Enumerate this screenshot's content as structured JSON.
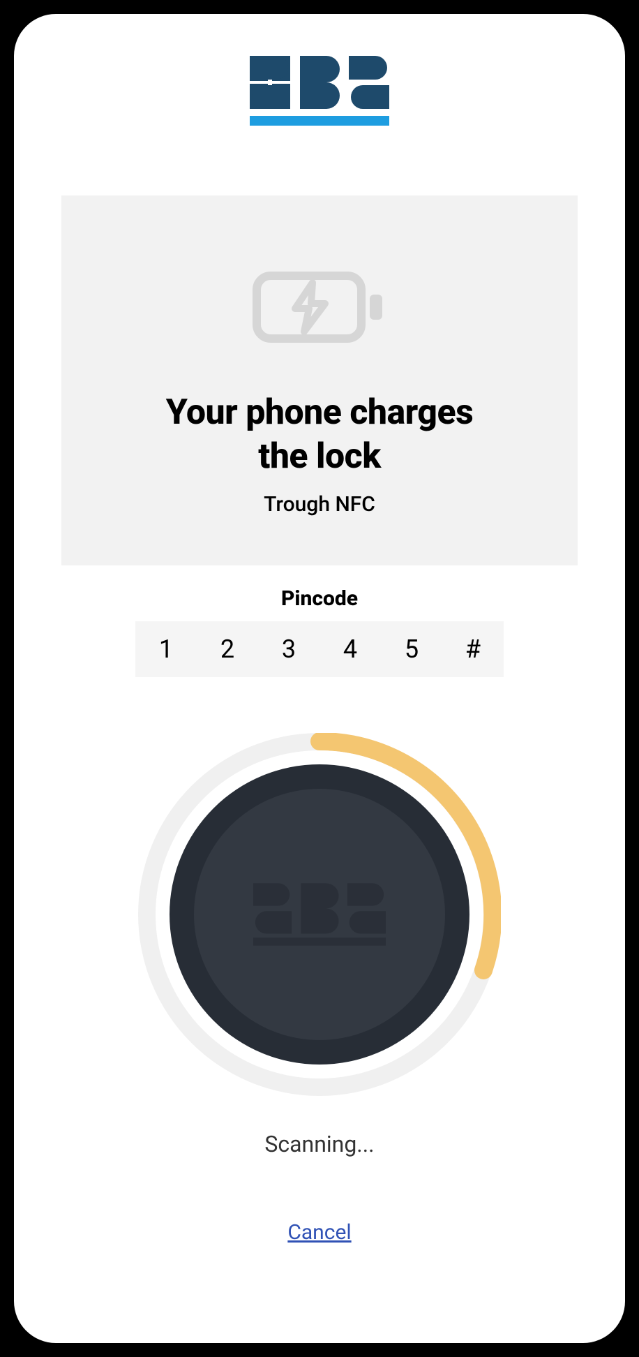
{
  "brand": {
    "name": "sbs",
    "logo_color_dark": "#1e4a6b",
    "logo_color_accent": "#1e9de0"
  },
  "info_card": {
    "title_line1": "Your phone charges",
    "title_line2": "the lock",
    "subtitle": "Trough NFC"
  },
  "pincode": {
    "label": "Pincode",
    "digits": [
      "1",
      "2",
      "3",
      "4",
      "5",
      "#"
    ]
  },
  "scanner": {
    "status": "Scanning...",
    "progress_color": "#f4c671",
    "arc_start_deg": 0,
    "arc_end_deg": 130
  },
  "actions": {
    "cancel": "Cancel"
  }
}
